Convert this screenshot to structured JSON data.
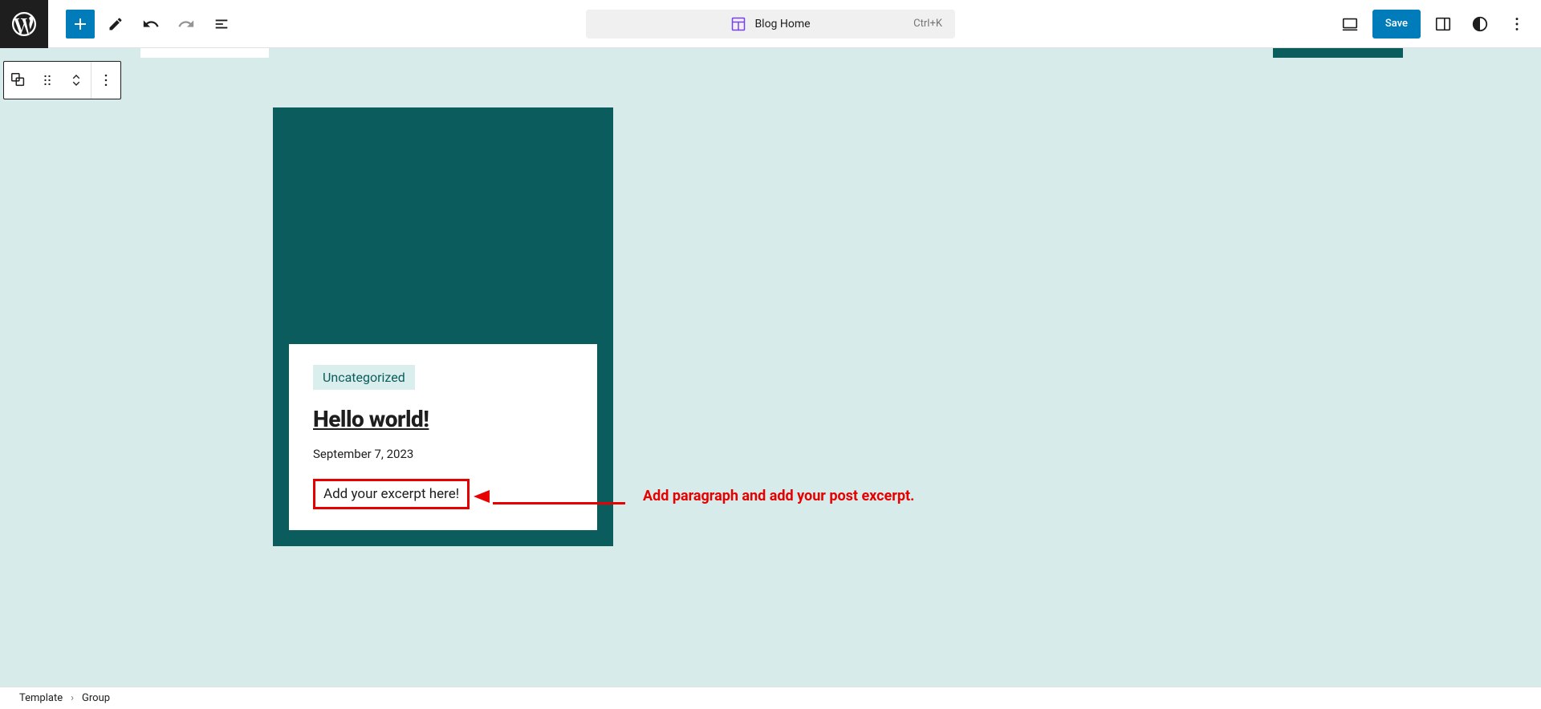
{
  "toolbar": {
    "center_label": "Blog Home",
    "center_shortcut": "Ctrl+K",
    "save_label": "Save"
  },
  "post": {
    "category": "Uncategorized",
    "title": "Hello world!",
    "date": "September 7, 2023",
    "excerpt": "Add your excerpt here!"
  },
  "annotation": {
    "text": "Add paragraph and add your post excerpt."
  },
  "breadcrumb": {
    "item1": "Template",
    "item2": "Group"
  }
}
